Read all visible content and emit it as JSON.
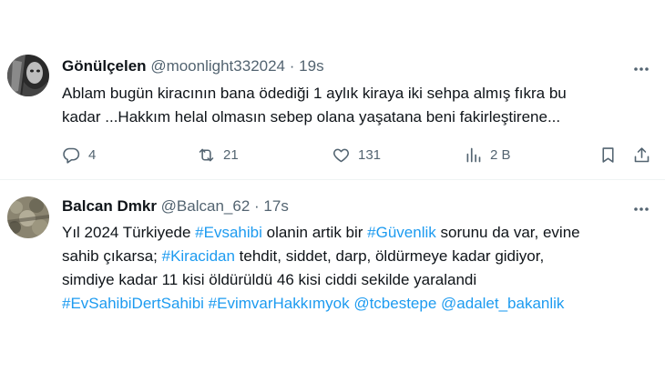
{
  "tweets": [
    {
      "display_name": "Gönülçelen",
      "handle": "@moonlight332024",
      "separator": "·",
      "time": "19s",
      "text_lines": [
        "Ablam bugün kiracının bana ödediği 1 aylık kiraya iki sehpa almış fıkra bu",
        "kadar ...Hakkım helal olmasın sebep olana yaşatana beni fakirleştirene..."
      ],
      "actions": {
        "replies": "4",
        "reposts": "21",
        "likes": "131",
        "views": "2 B"
      }
    },
    {
      "display_name": "Balcan Dmkr",
      "handle": "@Balcan_62",
      "separator": "·",
      "time": "17s",
      "segments": {
        "l1a": "Yıl 2024 Türkiyede ",
        "l1b": "#Evsahibi",
        "l1c": " olanin artik bir ",
        "l1d": "#Güvenlik",
        "l1e": " sorunu da var, evine",
        "l2a": "sahib çıkarsa; ",
        "l2b": "#Kiracidan",
        "l2c": " tehdit, siddet, darp, öldürmeye kadar gidiyor,",
        "l3a": "simdiye kadar 11 kisi öldürüldü 46 kisi ciddi sekilde yaralandi",
        "l4a": "#EvSahibiDertSahibi",
        "l4b": " ",
        "l4c": "#EvimvarHakkımyok",
        "l4d": " ",
        "l4e": "@tcbestepe",
        "l4f": " ",
        "l4g": "@adalet_bakanlik"
      }
    }
  ],
  "colors": {
    "text": "#0f1419",
    "secondary": "#536471",
    "link": "#1d9bf0",
    "divider": "#eff3f4"
  },
  "icons": [
    "reply-icon",
    "repost-icon",
    "like-icon",
    "views-icon",
    "bookmark-icon",
    "share-icon",
    "more-icon"
  ]
}
